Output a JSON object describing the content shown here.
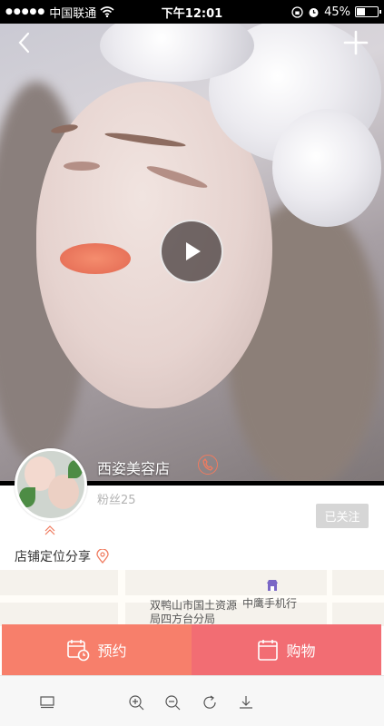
{
  "status_bar": {
    "signal": "●●●●●",
    "carrier": "中国联通",
    "time": "下午12:01",
    "battery": "45%",
    "battery_level": 0.45
  },
  "nav": {
    "back_icon": "chevron-left-icon",
    "add_icon": "plus-icon"
  },
  "video": {
    "play_icon": "play-icon"
  },
  "shop": {
    "name": "西姿美容店",
    "fans": "粉丝25",
    "follow_label": "已关注"
  },
  "location": {
    "share_label": "店铺定位分享"
  },
  "map": {
    "label_1": "双鸭山市国土资源局四方台分局",
    "label_2": "中鹰手机行"
  },
  "actions": {
    "book_label": "预约",
    "shop_label": "购物"
  },
  "toolbar": {
    "icons": [
      "layout-icon",
      "zoom-in-icon",
      "zoom-out-icon",
      "refresh-icon",
      "download-icon"
    ]
  },
  "colors": {
    "book": "#f77f6b",
    "shop": "#f26d73",
    "accent": "#f07b5f",
    "follow": "#d6d6d6"
  }
}
